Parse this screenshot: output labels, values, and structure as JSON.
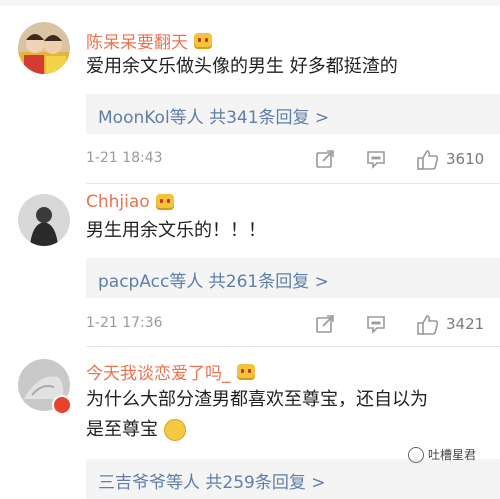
{
  "comments": [
    {
      "username": "陈呆呆要翻天",
      "text": "爱用余文乐做头像的男生 好多都挺渣的",
      "reply": "MoonKol等人 共341条回复 >",
      "time": "1-21 18:43",
      "likes": "3610"
    },
    {
      "username": "Chhjiao",
      "text": "男生用余文乐的！！！",
      "reply": "pacpAcc等人 共261条回复 >",
      "time": "1-21 17:36",
      "likes": "3421"
    },
    {
      "username": "今天我谈恋爱了吗_",
      "text_line1": "为什么大部分渣男都喜欢至尊宝，还自以为",
      "text_line2": "是至尊宝",
      "reply": "三吉爷爷等人 共259条回复 >"
    }
  ],
  "watermark": "吐槽星君",
  "icons": [
    "share-icon",
    "comment-icon",
    "like-icon",
    "vip-crown-icon"
  ],
  "colors": {
    "username": "#eb7350",
    "reply": "#5d7fa8",
    "meta": "#9a9a9a"
  }
}
